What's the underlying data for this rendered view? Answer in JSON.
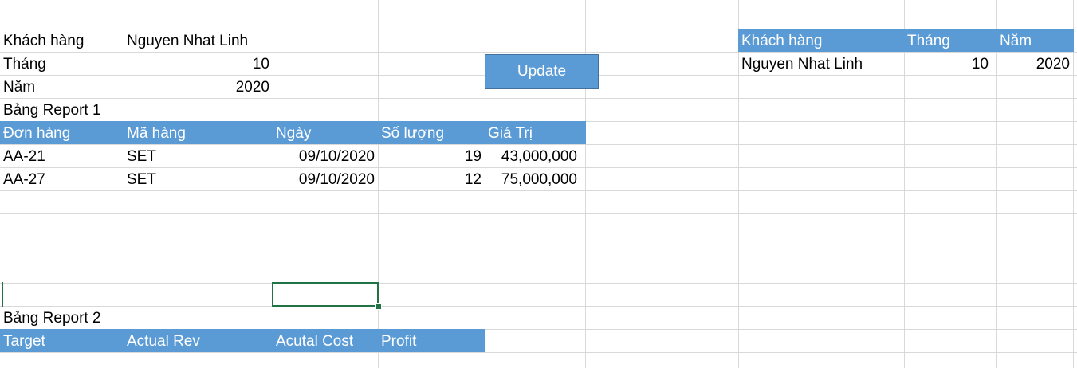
{
  "colors": {
    "header_fill": "#5b9bd5",
    "header_text": "#ffffff",
    "grid_line": "#d9d9d9",
    "selection": "#217346"
  },
  "info": {
    "customer_label": "Khách hàng",
    "customer_value": "Nguyen Nhat Linh",
    "month_label": "Tháng",
    "month_value": "10",
    "year_label": "Năm",
    "year_value": "2020"
  },
  "update_button": {
    "label": "Update"
  },
  "report1": {
    "title": "Bảng Report 1",
    "headers": [
      "Đơn hàng",
      "Mã hàng",
      "Ngày",
      "Số lượng",
      "Giá Trị"
    ],
    "rows": [
      [
        "AA-21",
        "SET",
        "09/10/2020",
        "19",
        "43,000,000"
      ],
      [
        "AA-27",
        "SET",
        "09/10/2020",
        "12",
        "75,000,000"
      ]
    ]
  },
  "report2": {
    "title": "Bảng Report 2",
    "headers": [
      "Target",
      "Actual Rev",
      "Acutal Cost",
      "Profit"
    ]
  },
  "right_table": {
    "headers": [
      "Khách hàng",
      "Tháng",
      "Năm"
    ],
    "row": [
      "Nguyen Nhat Linh",
      "10",
      "2020"
    ]
  }
}
